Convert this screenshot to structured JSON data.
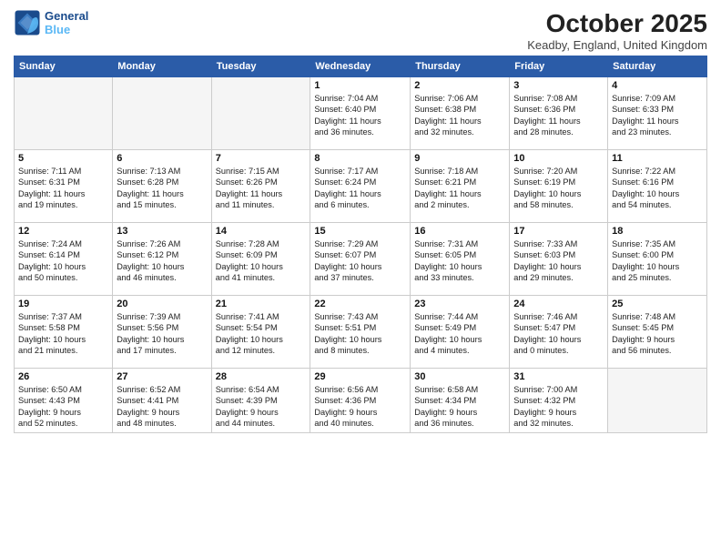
{
  "logo": {
    "line1": "General",
    "line2": "Blue"
  },
  "title": "October 2025",
  "location": "Keadby, England, United Kingdom",
  "weekdays": [
    "Sunday",
    "Monday",
    "Tuesday",
    "Wednesday",
    "Thursday",
    "Friday",
    "Saturday"
  ],
  "weeks": [
    [
      {
        "day": "",
        "info": ""
      },
      {
        "day": "",
        "info": ""
      },
      {
        "day": "",
        "info": ""
      },
      {
        "day": "1",
        "info": "Sunrise: 7:04 AM\nSunset: 6:40 PM\nDaylight: 11 hours\nand 36 minutes."
      },
      {
        "day": "2",
        "info": "Sunrise: 7:06 AM\nSunset: 6:38 PM\nDaylight: 11 hours\nand 32 minutes."
      },
      {
        "day": "3",
        "info": "Sunrise: 7:08 AM\nSunset: 6:36 PM\nDaylight: 11 hours\nand 28 minutes."
      },
      {
        "day": "4",
        "info": "Sunrise: 7:09 AM\nSunset: 6:33 PM\nDaylight: 11 hours\nand 23 minutes."
      }
    ],
    [
      {
        "day": "5",
        "info": "Sunrise: 7:11 AM\nSunset: 6:31 PM\nDaylight: 11 hours\nand 19 minutes."
      },
      {
        "day": "6",
        "info": "Sunrise: 7:13 AM\nSunset: 6:28 PM\nDaylight: 11 hours\nand 15 minutes."
      },
      {
        "day": "7",
        "info": "Sunrise: 7:15 AM\nSunset: 6:26 PM\nDaylight: 11 hours\nand 11 minutes."
      },
      {
        "day": "8",
        "info": "Sunrise: 7:17 AM\nSunset: 6:24 PM\nDaylight: 11 hours\nand 6 minutes."
      },
      {
        "day": "9",
        "info": "Sunrise: 7:18 AM\nSunset: 6:21 PM\nDaylight: 11 hours\nand 2 minutes."
      },
      {
        "day": "10",
        "info": "Sunrise: 7:20 AM\nSunset: 6:19 PM\nDaylight: 10 hours\nand 58 minutes."
      },
      {
        "day": "11",
        "info": "Sunrise: 7:22 AM\nSunset: 6:16 PM\nDaylight: 10 hours\nand 54 minutes."
      }
    ],
    [
      {
        "day": "12",
        "info": "Sunrise: 7:24 AM\nSunset: 6:14 PM\nDaylight: 10 hours\nand 50 minutes."
      },
      {
        "day": "13",
        "info": "Sunrise: 7:26 AM\nSunset: 6:12 PM\nDaylight: 10 hours\nand 46 minutes."
      },
      {
        "day": "14",
        "info": "Sunrise: 7:28 AM\nSunset: 6:09 PM\nDaylight: 10 hours\nand 41 minutes."
      },
      {
        "day": "15",
        "info": "Sunrise: 7:29 AM\nSunset: 6:07 PM\nDaylight: 10 hours\nand 37 minutes."
      },
      {
        "day": "16",
        "info": "Sunrise: 7:31 AM\nSunset: 6:05 PM\nDaylight: 10 hours\nand 33 minutes."
      },
      {
        "day": "17",
        "info": "Sunrise: 7:33 AM\nSunset: 6:03 PM\nDaylight: 10 hours\nand 29 minutes."
      },
      {
        "day": "18",
        "info": "Sunrise: 7:35 AM\nSunset: 6:00 PM\nDaylight: 10 hours\nand 25 minutes."
      }
    ],
    [
      {
        "day": "19",
        "info": "Sunrise: 7:37 AM\nSunset: 5:58 PM\nDaylight: 10 hours\nand 21 minutes."
      },
      {
        "day": "20",
        "info": "Sunrise: 7:39 AM\nSunset: 5:56 PM\nDaylight: 10 hours\nand 17 minutes."
      },
      {
        "day": "21",
        "info": "Sunrise: 7:41 AM\nSunset: 5:54 PM\nDaylight: 10 hours\nand 12 minutes."
      },
      {
        "day": "22",
        "info": "Sunrise: 7:43 AM\nSunset: 5:51 PM\nDaylight: 10 hours\nand 8 minutes."
      },
      {
        "day": "23",
        "info": "Sunrise: 7:44 AM\nSunset: 5:49 PM\nDaylight: 10 hours\nand 4 minutes."
      },
      {
        "day": "24",
        "info": "Sunrise: 7:46 AM\nSunset: 5:47 PM\nDaylight: 10 hours\nand 0 minutes."
      },
      {
        "day": "25",
        "info": "Sunrise: 7:48 AM\nSunset: 5:45 PM\nDaylight: 9 hours\nand 56 minutes."
      }
    ],
    [
      {
        "day": "26",
        "info": "Sunrise: 6:50 AM\nSunset: 4:43 PM\nDaylight: 9 hours\nand 52 minutes."
      },
      {
        "day": "27",
        "info": "Sunrise: 6:52 AM\nSunset: 4:41 PM\nDaylight: 9 hours\nand 48 minutes."
      },
      {
        "day": "28",
        "info": "Sunrise: 6:54 AM\nSunset: 4:39 PM\nDaylight: 9 hours\nand 44 minutes."
      },
      {
        "day": "29",
        "info": "Sunrise: 6:56 AM\nSunset: 4:36 PM\nDaylight: 9 hours\nand 40 minutes."
      },
      {
        "day": "30",
        "info": "Sunrise: 6:58 AM\nSunset: 4:34 PM\nDaylight: 9 hours\nand 36 minutes."
      },
      {
        "day": "31",
        "info": "Sunrise: 7:00 AM\nSunset: 4:32 PM\nDaylight: 9 hours\nand 32 minutes."
      },
      {
        "day": "",
        "info": ""
      }
    ]
  ]
}
